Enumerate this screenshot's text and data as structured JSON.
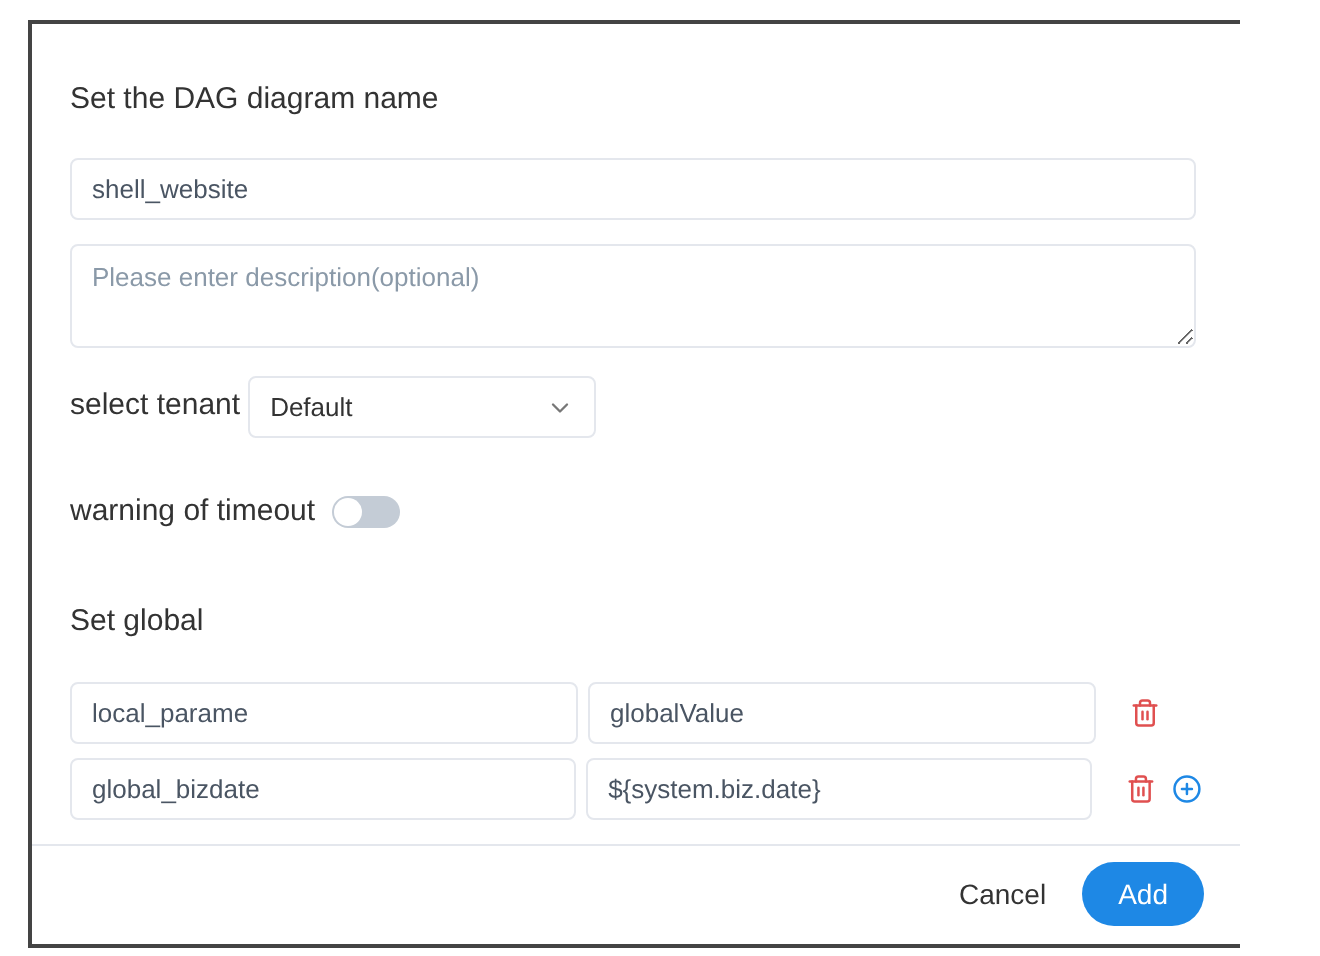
{
  "dialog": {
    "name_label": "Set the DAG diagram name",
    "name_value": "shell_website",
    "description": {
      "placeholder": "Please enter description(optional)"
    },
    "tenant": {
      "label": "select tenant",
      "value": "Default"
    },
    "timeout": {
      "label": "warning of timeout",
      "on": false
    },
    "global": {
      "label": "Set global",
      "params": [
        {
          "key": "local_parame",
          "value": "globalValue",
          "can_add": false
        },
        {
          "key": "global_bizdate",
          "value": "${system.biz.date}",
          "can_add": true
        }
      ]
    },
    "buttons": {
      "cancel": "Cancel",
      "confirm": "Add"
    }
  }
}
